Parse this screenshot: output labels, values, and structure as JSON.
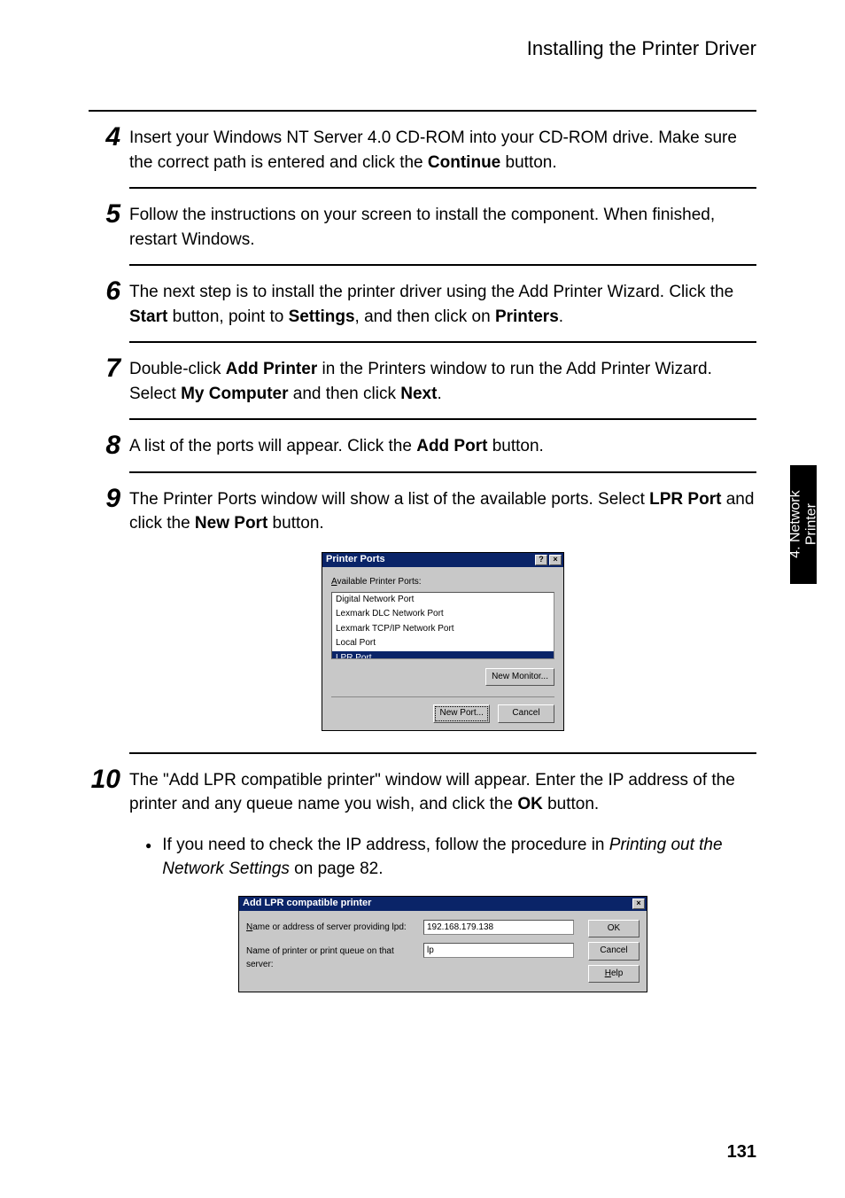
{
  "header": {
    "title": "Installing the Printer Driver"
  },
  "side_tab": {
    "line1": "4. Network",
    "line2": "Printer"
  },
  "page_number": "131",
  "steps": {
    "s4": {
      "num": "4",
      "t1": "Insert your Windows NT Server 4.0 CD-ROM into your CD-ROM drive.  Make sure the correct path is entered and click the ",
      "b1": "Continue",
      "t2": " button."
    },
    "s5": {
      "num": "5",
      "t1": "Follow the instructions on your screen to install the component. When finished, restart Windows."
    },
    "s6": {
      "num": "6",
      "t1": "The next step is to install the printer driver using the Add Printer Wizard. Click the ",
      "b1": "Start",
      "t2": " button, point to ",
      "b2": "Settings",
      "t3": ", and then click on ",
      "b3": "Printers",
      "t4": "."
    },
    "s7": {
      "num": "7",
      "t1": "Double-click ",
      "b1": "Add Printer",
      "t2": " in the Printers window to run the Add Printer Wizard. Select ",
      "b2": "My Computer",
      "t3": " and then click ",
      "b3": "Next",
      "t4": "."
    },
    "s8": {
      "num": "8",
      "t1": "A list of the ports will appear. Click the ",
      "b1": "Add Port",
      "t2": " button."
    },
    "s9": {
      "num": "9",
      "t1": "The Printer Ports window will show a list of the available ports.  Select ",
      "b1": "LPR Port",
      "t2": " and click the ",
      "b2": "New Port",
      "t3": " button."
    },
    "s10": {
      "num": "10",
      "t1": "The \"Add LPR compatible printer\" window will appear.  Enter the IP address of the printer and any queue name you wish, and click the ",
      "b1": "OK",
      "t2": " button.",
      "bullet_t1": "If you need to check the IP address, follow the procedure in ",
      "bullet_i1": "Printing out the Network Settings",
      "bullet_t2": " on page 82."
    }
  },
  "dialog1": {
    "title": "Printer Ports",
    "help_glyph": "?",
    "close_glyph": "×",
    "label": "Available Printer Ports:",
    "items": [
      "Digital Network Port",
      "Lexmark DLC Network Port",
      "Lexmark TCP/IP Network Port",
      "Local Port",
      "LPR Port"
    ],
    "new_monitor": "New Monitor...",
    "new_port": "New Port...",
    "cancel": "Cancel"
  },
  "dialog2": {
    "title": "Add LPR compatible printer",
    "close_glyph": "×",
    "label1": "Name or address of server providing lpd:",
    "label2": "Name of printer or print queue on that server:",
    "input1": "192.168.179.138",
    "input2": "lp",
    "ok": "OK",
    "cancel": "Cancel",
    "help": "Help"
  }
}
